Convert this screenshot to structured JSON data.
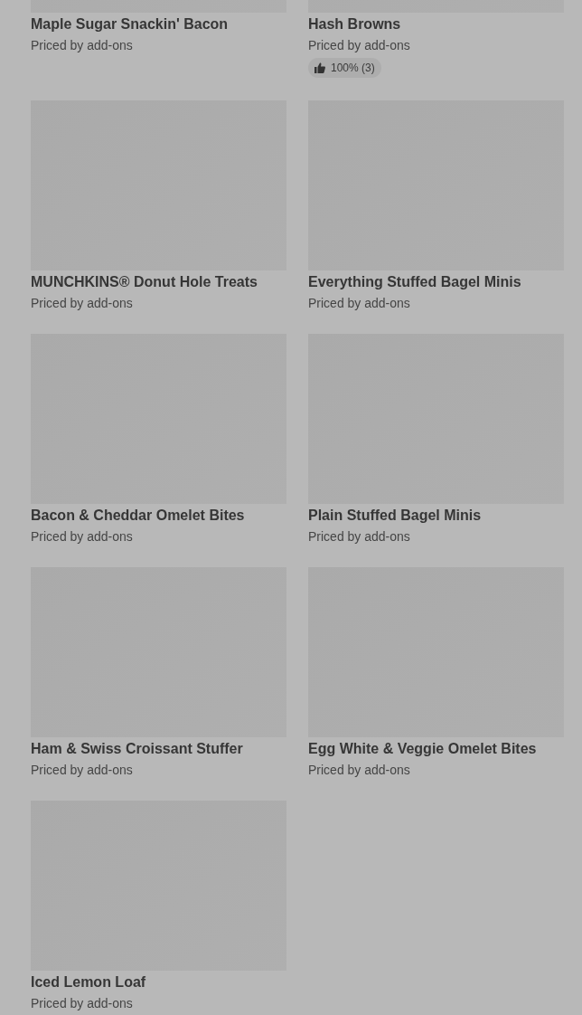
{
  "items": [
    {
      "name": "Maple Sugar Snackin' Bacon",
      "price_note": "Priced by add-ons"
    },
    {
      "name": "Hash Browns",
      "price_note": "Priced by add-ons",
      "rating": "100% (3)"
    },
    {
      "name": "MUNCHKINS® Donut Hole Treats",
      "price_note": "Priced by add-ons"
    },
    {
      "name": "Everything Stuffed Bagel Minis",
      "price_note": "Priced by add-ons"
    },
    {
      "name": "Bacon & Cheddar Omelet Bites",
      "price_note": "Priced by add-ons"
    },
    {
      "name": "Plain Stuffed Bagel Minis",
      "price_note": "Priced by add-ons"
    },
    {
      "name": "Ham & Swiss Croissant Stuffer",
      "price_note": "Priced by add-ons"
    },
    {
      "name": "Egg White & Veggie Omelet Bites",
      "price_note": "Priced by add-ons"
    },
    {
      "name": "Iced Lemon Loaf",
      "price_note": "Priced by add-ons"
    }
  ]
}
